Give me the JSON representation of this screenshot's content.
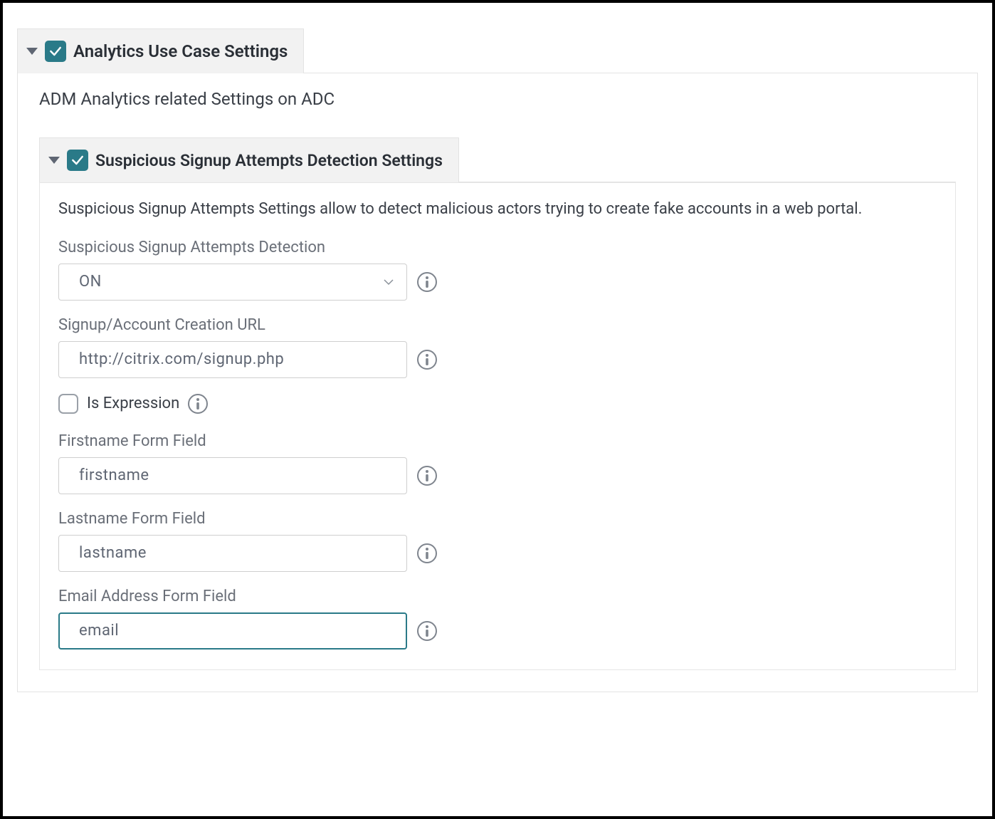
{
  "outer": {
    "header": "Analytics Use Case Settings",
    "subtitle": "ADM Analytics related Settings on ADC"
  },
  "inner": {
    "header": "Suspicious Signup Attempts Detection Settings",
    "description": "Suspicious Signup Attempts Settings allow to detect malicious actors trying to create fake accounts in a web portal."
  },
  "fields": {
    "detection": {
      "label": "Suspicious Signup Attempts Detection",
      "value": "ON"
    },
    "signup_url": {
      "label": "Signup/Account Creation URL",
      "value": "http://citrix.com/signup.php"
    },
    "is_expression": {
      "label": "Is Expression",
      "checked": false
    },
    "firstname": {
      "label": "Firstname Form Field",
      "value": "firstname"
    },
    "lastname": {
      "label": "Lastname Form Field",
      "value": "lastname"
    },
    "email": {
      "label": "Email Address Form Field",
      "value": "email"
    }
  }
}
